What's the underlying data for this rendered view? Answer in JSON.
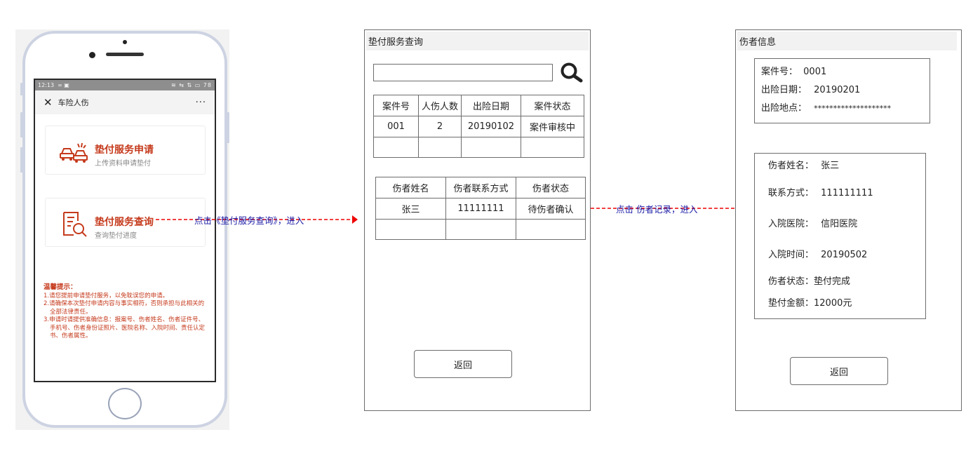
{
  "phone": {
    "status_time": "12:13",
    "status_icons_left": "∞ ▣",
    "status_icons_right": "≋ ⇆ ⇅ ▭ 78",
    "nav_title": "车险人伤",
    "nav_more": "···",
    "cards": [
      {
        "title": "垫付服务申请",
        "subtitle": "上传资料申请垫付",
        "icon": "car-accident-icon"
      },
      {
        "title": "垫付服务查询",
        "subtitle": "查询垫付进度",
        "icon": "document-search-icon"
      }
    ],
    "tips": {
      "title": "温馨提示：",
      "items": [
        "1.请您提前申请垫付服务，以免耽误您的申请。",
        "2.请确保本次垫付申请内容与事实相符，否则承担与此相关的全部法律责任。",
        "3.申请时请提供准确信息：报案号、伤者姓名、伤者证件号、手机号、伤者身份证照片、医院名称、入院时间、责任认定书、伤者属性。"
      ]
    }
  },
  "arrows": {
    "first_label": "点击《垫付服务查询》，进入",
    "second_label": "点击 伤者记录，进入"
  },
  "query_panel": {
    "title": "垫付服务查询",
    "search_placeholder": "",
    "case_table": {
      "headers": [
        "案件号",
        "人伤人数",
        "出险日期",
        "案件状态"
      ],
      "rows": [
        [
          "001",
          "2",
          "20190102",
          "案件审核中"
        ],
        [
          "",
          "",
          "",
          ""
        ]
      ]
    },
    "injured_table": {
      "headers": [
        "伤者姓名",
        "伤者联系方式",
        "伤者状态"
      ],
      "rows": [
        [
          "张三",
          "11111111",
          "待伤者确认"
        ],
        [
          "",
          "",
          ""
        ]
      ]
    },
    "back_label": "返回"
  },
  "detail_panel": {
    "title": "伤者信息",
    "case_info": {
      "case_no_label": "案件号：",
      "case_no": "0001",
      "date_label": "出险日期：",
      "date": "20190201",
      "place_label": "出险地点：",
      "place": "********************"
    },
    "injured_info": {
      "name_label": "伤者姓名：",
      "name": "张三",
      "contact_label": "联系方式：",
      "contact": "111111111",
      "hospital_label": "入院医院：",
      "hospital": "信阳医院",
      "admit_label": "入院时间：",
      "admit_time": "20190502",
      "status_label": "伤者状态：",
      "status": "垫付完成",
      "amount_label": "垫付金额：",
      "amount": "12000元"
    },
    "back_label": "返回"
  },
  "colors": {
    "accent_red": "#c53a1c",
    "arrow_red": "#ee0000",
    "label_blue": "#1a1aa6"
  }
}
